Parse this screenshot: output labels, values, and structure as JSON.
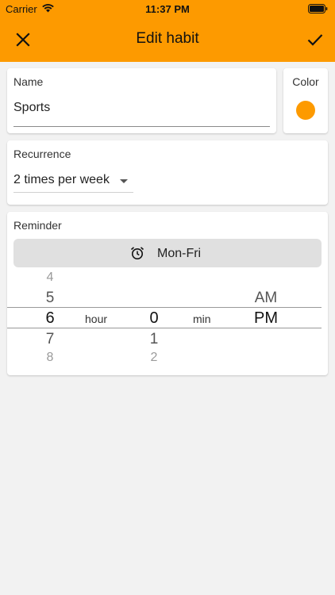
{
  "status": {
    "carrier": "Carrier",
    "time": "11:37 PM"
  },
  "toolbar": {
    "title": "Edit habit"
  },
  "colors": {
    "accent": "#fd9a00",
    "habit_color": "#fd9a00"
  },
  "icons": {
    "close": "close-icon",
    "save": "check-icon",
    "alarm": "alarm-icon",
    "caret": "caret-down-icon"
  },
  "name_card": {
    "label": "Name",
    "value": "Sports"
  },
  "color_card": {
    "label": "Color"
  },
  "recurrence_card": {
    "label": "Recurrence",
    "value": "2 times per week"
  },
  "reminder_card": {
    "label": "Reminder",
    "days": "Mon-Fri",
    "hour_column": {
      "above2": "4",
      "above1": "5",
      "selected": "6",
      "below1": "7",
      "below2": "8",
      "unit": "hour"
    },
    "minute_column": {
      "selected": "0",
      "below1": "1",
      "below2": "2",
      "unit": "min"
    },
    "period_column": {
      "above1": "AM",
      "selected": "PM"
    }
  }
}
